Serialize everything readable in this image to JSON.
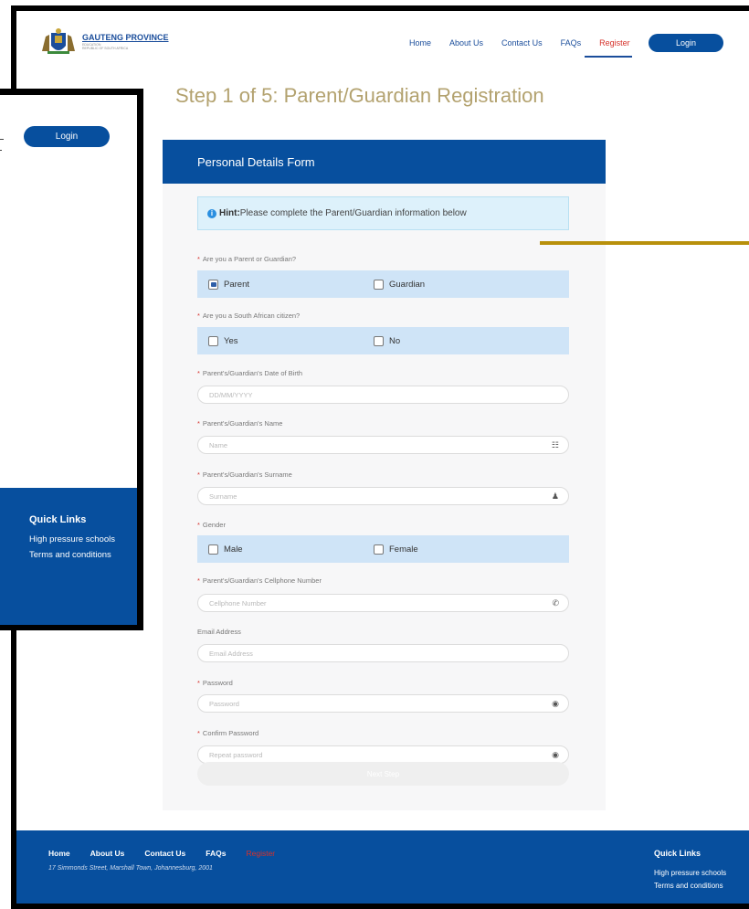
{
  "header": {
    "logo_title": "GAUTENG PROVINCE",
    "logo_sub1": "EDUCATION",
    "logo_sub2": "REPUBLIC OF SOUTH AFRICA",
    "nav": [
      "Home",
      "About Us",
      "Contact Us",
      "FAQs",
      "Register"
    ],
    "active_nav": "Register",
    "login_label": "Login"
  },
  "page_title": "Step 1 of 5: Parent/Guardian Registration",
  "form": {
    "header": "Personal Details Form",
    "hint_bold": "Hint:",
    "hint_text": "Please complete the Parent/Guardian information below",
    "q_parent_or_guardian": "Are you a Parent or Guardian?",
    "opt_parent": "Parent",
    "opt_guardian": "Guardian",
    "selected_role": "Parent",
    "q_citizen": "Are you a South African citizen?",
    "opt_yes": "Yes",
    "opt_no": "No",
    "lbl_dob": "Parent's/Guardian's Date of Birth",
    "ph_dob": "DD/MM/YYYY",
    "lbl_name": "Parent's/Guardian's Name",
    "ph_name": "Name",
    "lbl_surname": "Parent's/Guardian's Surname",
    "ph_surname": "Surname",
    "lbl_gender": "Gender",
    "opt_male": "Male",
    "opt_female": "Female",
    "lbl_cell": "Parent's/Guardian's Cellphone Number",
    "ph_cell": "Cellphone Number",
    "lbl_email": "Email Address",
    "ph_email": "Email Address",
    "lbl_password": "Password",
    "ph_password": "Password",
    "lbl_confirm": "Confirm Password",
    "ph_confirm": "Repeat password",
    "submit_label": "Next Step"
  },
  "footer": {
    "links": [
      "Home",
      "About Us",
      "Contact Us",
      "FAQs",
      "Register"
    ],
    "address": "17 Simmonds Street, Marshall Town, Johannesburg, 2001",
    "quick_links_title": "Quick Links",
    "quick_links": [
      "High pressure schools",
      "Terms and conditions"
    ]
  },
  "inset": {
    "login_label": "Login",
    "quick_links_title": "Quick Links",
    "quick_links": [
      "High pressure schools",
      "Terms and conditions"
    ]
  },
  "colors": {
    "brand_blue": "#074f9e",
    "title_gold": "#b3a26f",
    "active_red": "#d6312a",
    "connector_gold": "#b8900b"
  }
}
